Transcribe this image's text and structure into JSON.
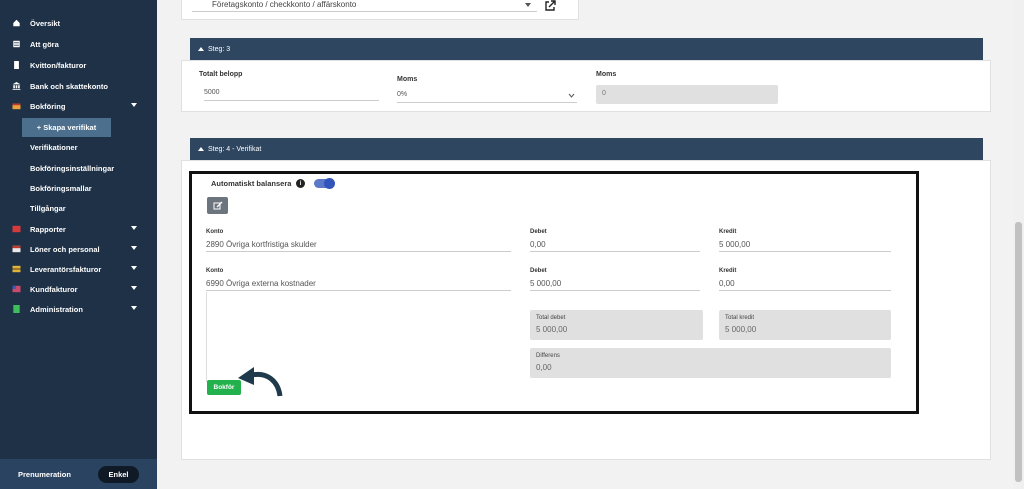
{
  "sidebar": {
    "items": [
      {
        "label": "Översikt",
        "icon": "home-icon"
      },
      {
        "label": "Att göra",
        "icon": "list-icon"
      },
      {
        "label": "Kvitton/fakturor",
        "icon": "receipt-icon"
      },
      {
        "label": "Bank och skattekonto",
        "icon": "bank-icon"
      },
      {
        "label": "Bokföring",
        "icon": "book-icon"
      },
      {
        "label": "Rapporter",
        "icon": "chart-icon"
      },
      {
        "label": "Löner och personal",
        "icon": "people-icon"
      },
      {
        "label": "Leverantörsfakturor",
        "icon": "invoice-in-icon"
      },
      {
        "label": "Kundfakturor",
        "icon": "invoice-out-icon"
      },
      {
        "label": "Administration",
        "icon": "admin-icon"
      }
    ],
    "active_sub": "+ Skapa verifikat",
    "sub_items": [
      "Verifikationer",
      "Bokföringsinställningar",
      "Bokföringsmallar",
      "Tillgångar"
    ],
    "footer": {
      "prenumeration": "Prenumeration",
      "plan": "Enkel"
    }
  },
  "top": {
    "account_select": "Företagskonto / checkkonto / affärskonto"
  },
  "step3": {
    "title": "Steg: 3",
    "total_label": "Totalt belopp",
    "total_value": "5000",
    "moms_label": "Moms",
    "moms_select": "0%",
    "moms2_label": "Moms",
    "moms2_value": "0"
  },
  "step4": {
    "title": "Steg: 4 - Verifikat",
    "auto_balance_label": "Automatiskt balansera",
    "info": "i",
    "rows": [
      {
        "konto_label": "Konto",
        "konto": "2890 Övriga kortfristiga skulder",
        "debet_label": "Debet",
        "debet": "0,00",
        "kredit_label": "Kredit",
        "kredit": "5 000,00"
      },
      {
        "konto_label": "Konto",
        "konto": "6990 Övriga externa kostnader",
        "debet_label": "Debet",
        "debet": "5 000,00",
        "kredit_label": "Kredit",
        "kredit": "0,00"
      }
    ],
    "total_debet_label": "Total debet",
    "total_debet": "5 000,00",
    "total_kredit_label": "Total kredit",
    "total_kredit": "5 000,00",
    "differens_label": "Differens",
    "differens": "0,00",
    "bokfor": "Bokför"
  },
  "colors": {
    "sidebar": "#1e3147",
    "step_bar": "#2e4660",
    "accent_green": "#22b14c",
    "toggle": "#3355bb"
  }
}
